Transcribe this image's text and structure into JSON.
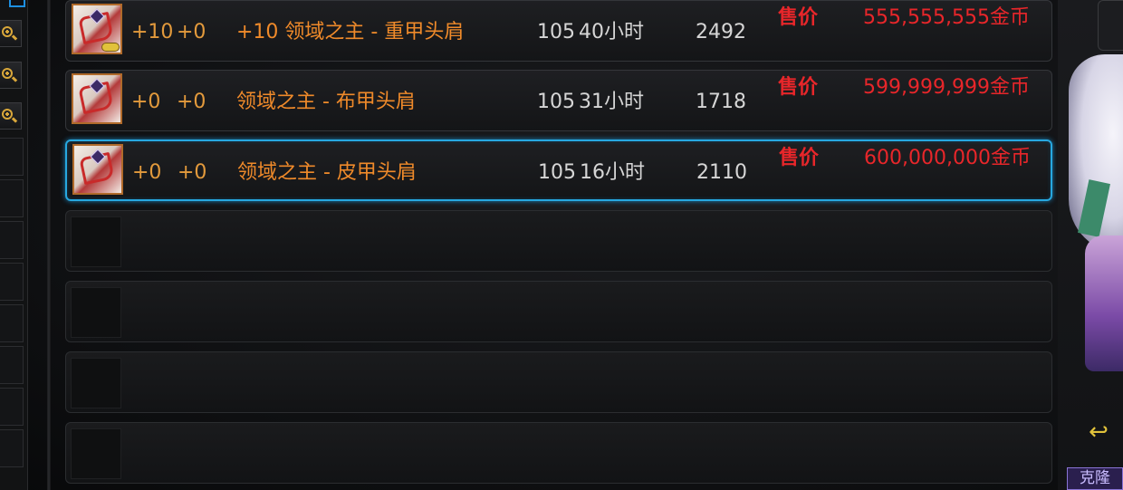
{
  "auction_list": {
    "rows": [
      {
        "enhance": "+10",
        "amplify": "+0",
        "name": "+10 领域之主 - 重甲头肩",
        "level": "105",
        "time_left": "40小时",
        "count": "2492",
        "price_label": "售价",
        "price": "555,555,555金币",
        "icon": "shoulder-armor-icon",
        "selected": false
      },
      {
        "enhance": "+0",
        "amplify": "+0",
        "name": "领域之主 - 布甲头肩",
        "level": "105",
        "time_left": "31小时",
        "count": "1718",
        "price_label": "售价",
        "price": "599,999,999金币",
        "icon": "shoulder-armor-icon",
        "selected": false
      },
      {
        "enhance": "+0",
        "amplify": "+0",
        "name": "领域之主 - 皮甲头肩",
        "level": "105",
        "time_left": "16小时",
        "count": "2110",
        "price_label": "售价",
        "price": "600,000,000金币",
        "icon": "shoulder-armor-icon",
        "selected": true
      }
    ],
    "empty_slots": 4
  },
  "sidebar": {
    "zoom_icons": [
      "zoom-in-icon",
      "zoom-in-icon",
      "zoom-in-icon"
    ]
  },
  "portrait": {
    "return_icon": "return-arrow-icon",
    "clone_label": "克隆"
  },
  "colors": {
    "name_orange": "#ef8a2a",
    "price_red": "#e8262a",
    "selection_blue": "#27a8e0"
  }
}
